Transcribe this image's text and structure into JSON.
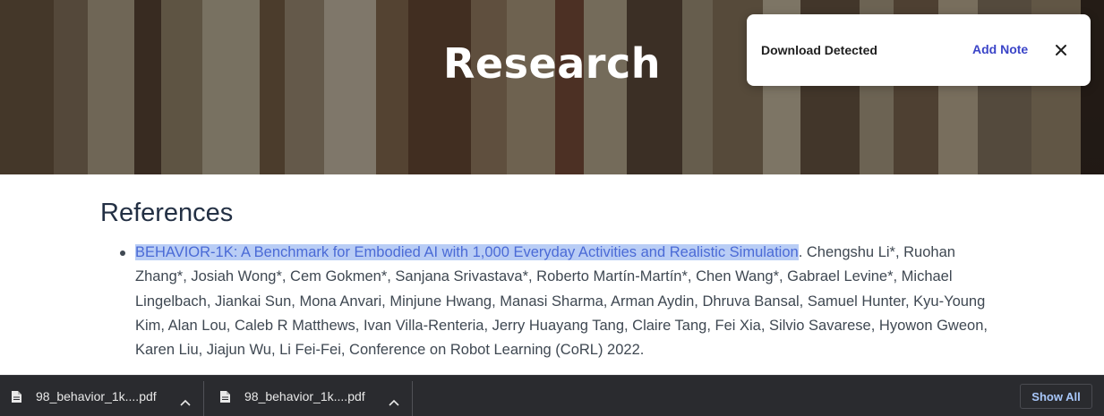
{
  "hero": {
    "title": "Research"
  },
  "popup": {
    "title": "Download Detected",
    "action_label": "Add Note",
    "close_icon": "close-icon"
  },
  "references": {
    "heading": "References",
    "items": [
      {
        "link_text": "BEHAVIOR-1K: A Benchmark for Embodied AI with 1,000 Everyday Activities and Realistic Simulation",
        "rest_text": ". Chengshu Li*, Ruohan Zhang*, Josiah Wong*, Cem Gokmen*, Sanjana Srivastava*, Roberto Martín-Martín*, Chen Wang*, Gabrael Levine*, Michael Lingelbach, Jiankai Sun, Mona Anvari, Minjune Hwang, Manasi Sharma, Arman Aydin, Dhruva Bansal, Samuel Hunter, Kyu-Young Kim, Alan Lou, Caleb R Matthews, Ivan Villa-Renteria, Jerry Huayang Tang, Claire Tang, Fei Xia, Silvio Savarese, Hyowon Gweon, Karen Liu, Jiajun Wu, Li Fei-Fei, Conference on Robot Learning (CoRL) 2022."
      }
    ]
  },
  "downloads": {
    "items": [
      {
        "name": "98_behavior_1k....pdf",
        "icon": "file-icon",
        "menu_icon": "chevron-up-icon"
      },
      {
        "name": "98_behavior_1k....pdf",
        "icon": "file-icon",
        "menu_icon": "chevron-up-icon"
      }
    ],
    "show_all_label": "Show All"
  },
  "colors": {
    "link": "#4a6ad6",
    "selection": "#b9cdf5",
    "popup_action": "#3b45c8",
    "download_bar": "#2a2b2f",
    "show_all": "#a8c7fa"
  }
}
